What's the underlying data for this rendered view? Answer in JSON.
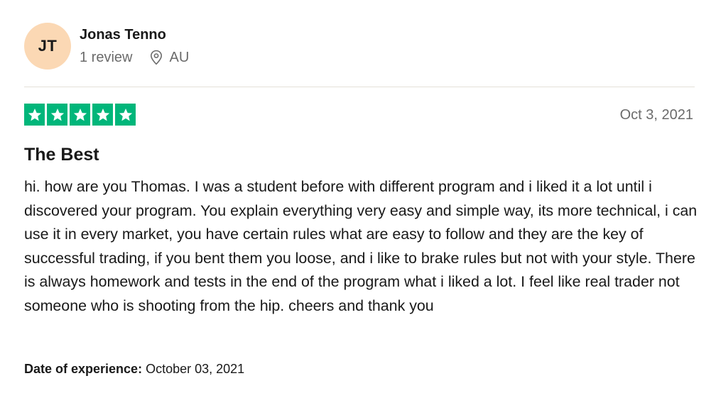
{
  "reviewer": {
    "initials": "JT",
    "name": "Jonas Tenno",
    "review_count": "1 review",
    "location": "AU",
    "location_icon": "location-pin-icon",
    "avatar_color": "#fbd8b4"
  },
  "rating": {
    "stars": 5,
    "max_stars": 5,
    "star_color": "#00b67a",
    "star_icon": "star-icon"
  },
  "review": {
    "date": "Oct 3, 2021",
    "title": "The Best",
    "body": "hi. how are you Thomas. I was a student before with different program and i liked it a lot until i discovered your program. You explain everything very easy and simple way, its more technical, i can use it in every market, you have certain rules what are easy to follow and they are the key of successful trading, if you bent them you loose, and i like to brake rules but not with your style. There is always homework and tests in the end of the program what i liked a lot. I feel like real trader not someone who is shooting from the hip. cheers and thank you"
  },
  "experience": {
    "label": "Date of experience:",
    "value": "October 03, 2021"
  }
}
